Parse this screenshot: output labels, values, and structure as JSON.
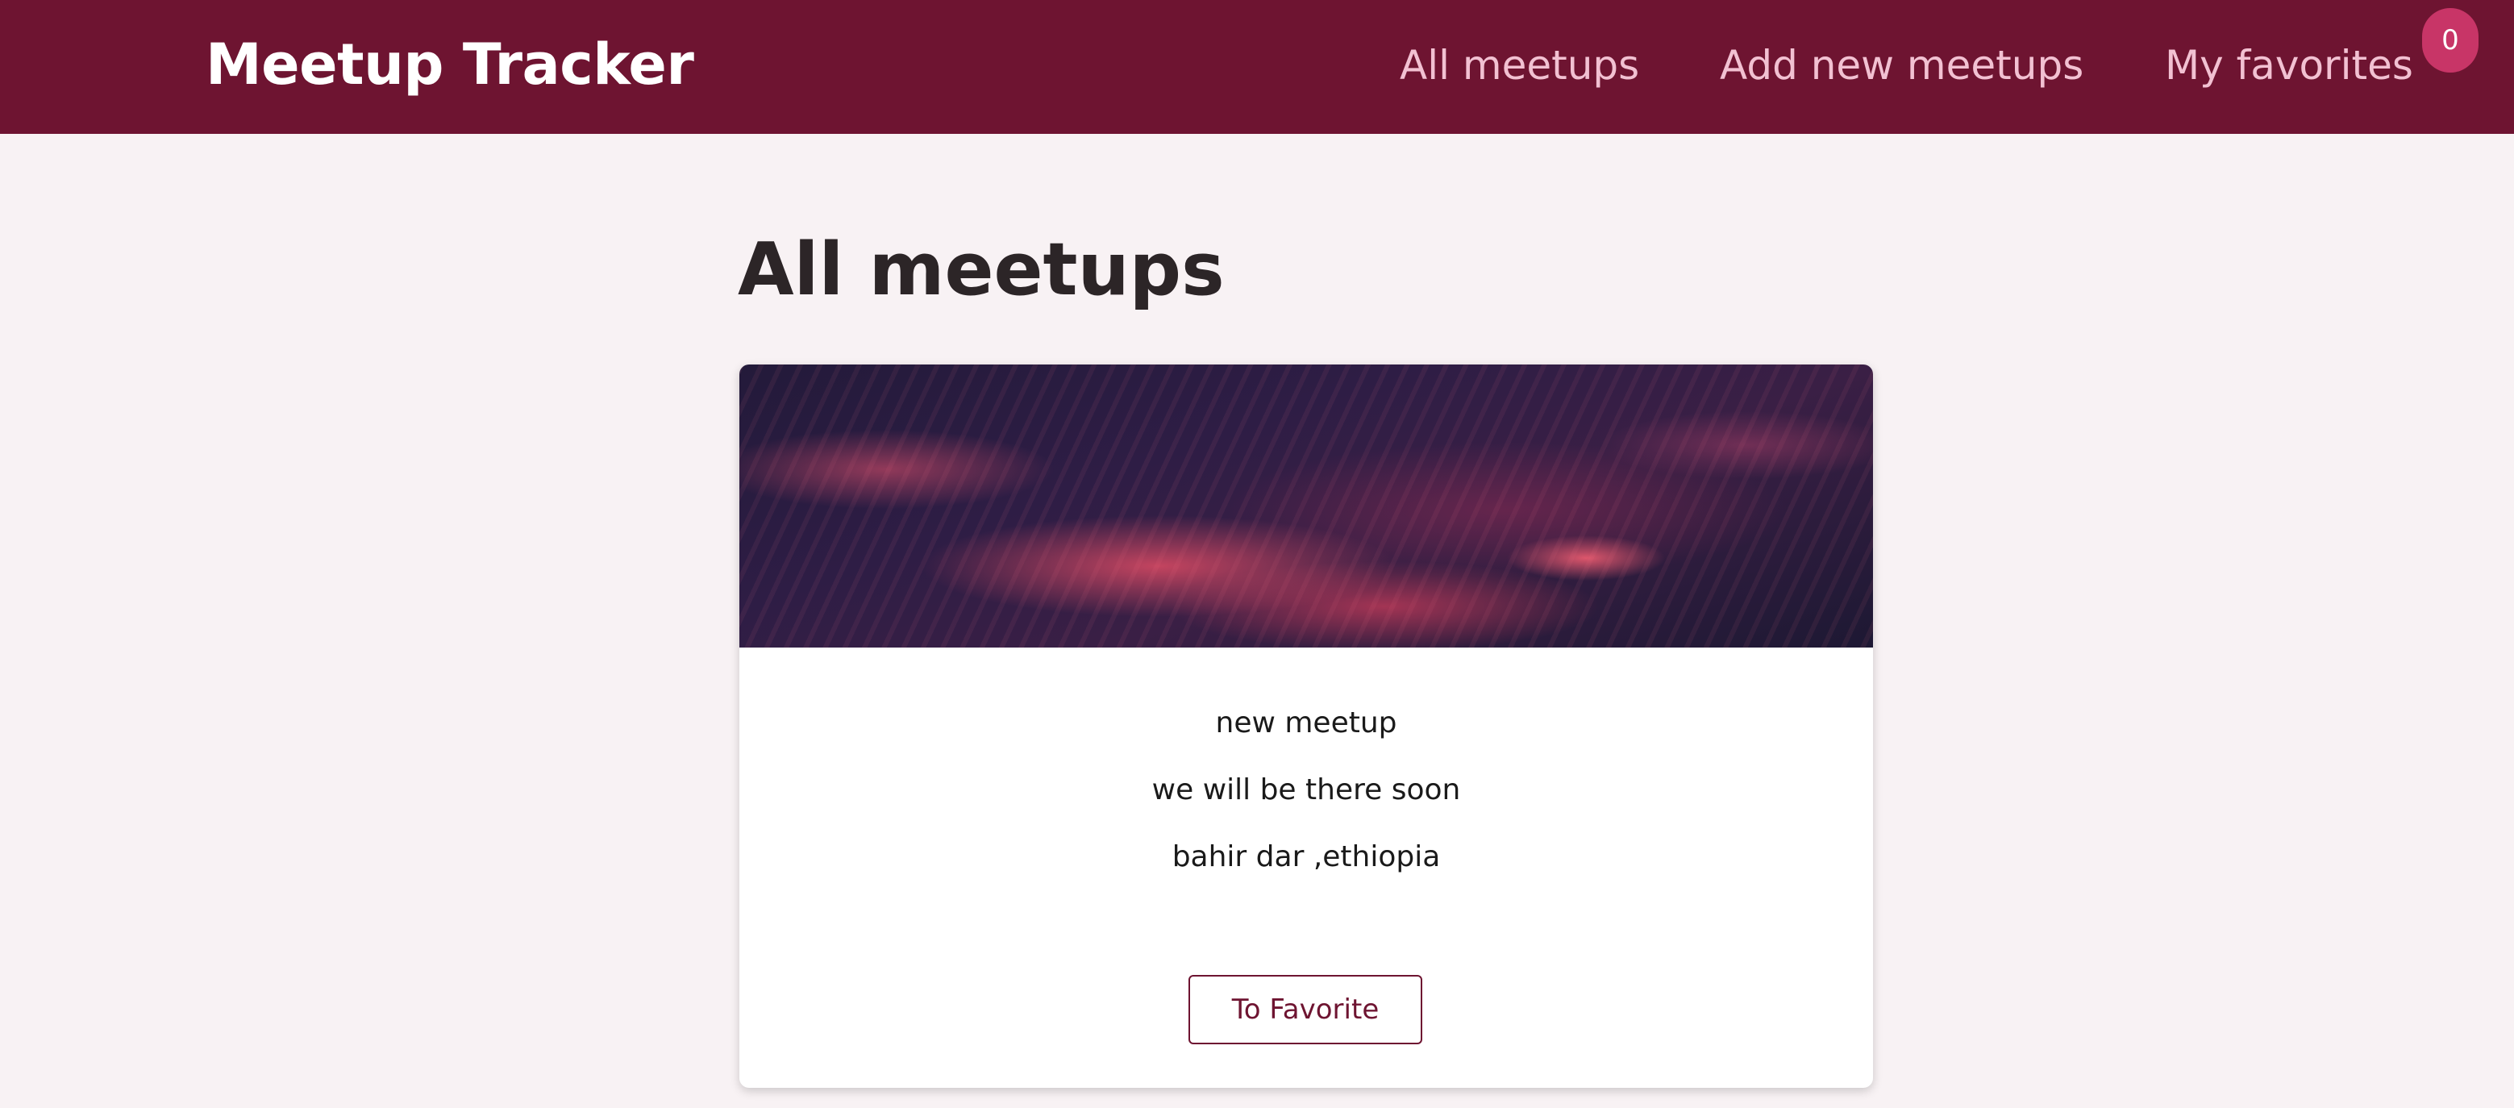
{
  "header": {
    "logo": "Meetup Tracker",
    "nav": {
      "all_meetups": "All meetups",
      "add_new_meetups": "Add new meetups",
      "my_favorites": "My favorites"
    },
    "favorites_count": "0"
  },
  "main": {
    "title": "All meetups",
    "meetups": [
      {
        "title": "new meetup",
        "description": "we will be there soon",
        "address": "bahir dar ,ethiopia",
        "button_label": "To Favorite"
      }
    ]
  },
  "colors": {
    "header_bg": "#6e1431",
    "nav_text": "#f2c1d2",
    "badge_bg": "#c83567",
    "page_bg": "#f8f2f4",
    "button_border": "#6e1431"
  }
}
